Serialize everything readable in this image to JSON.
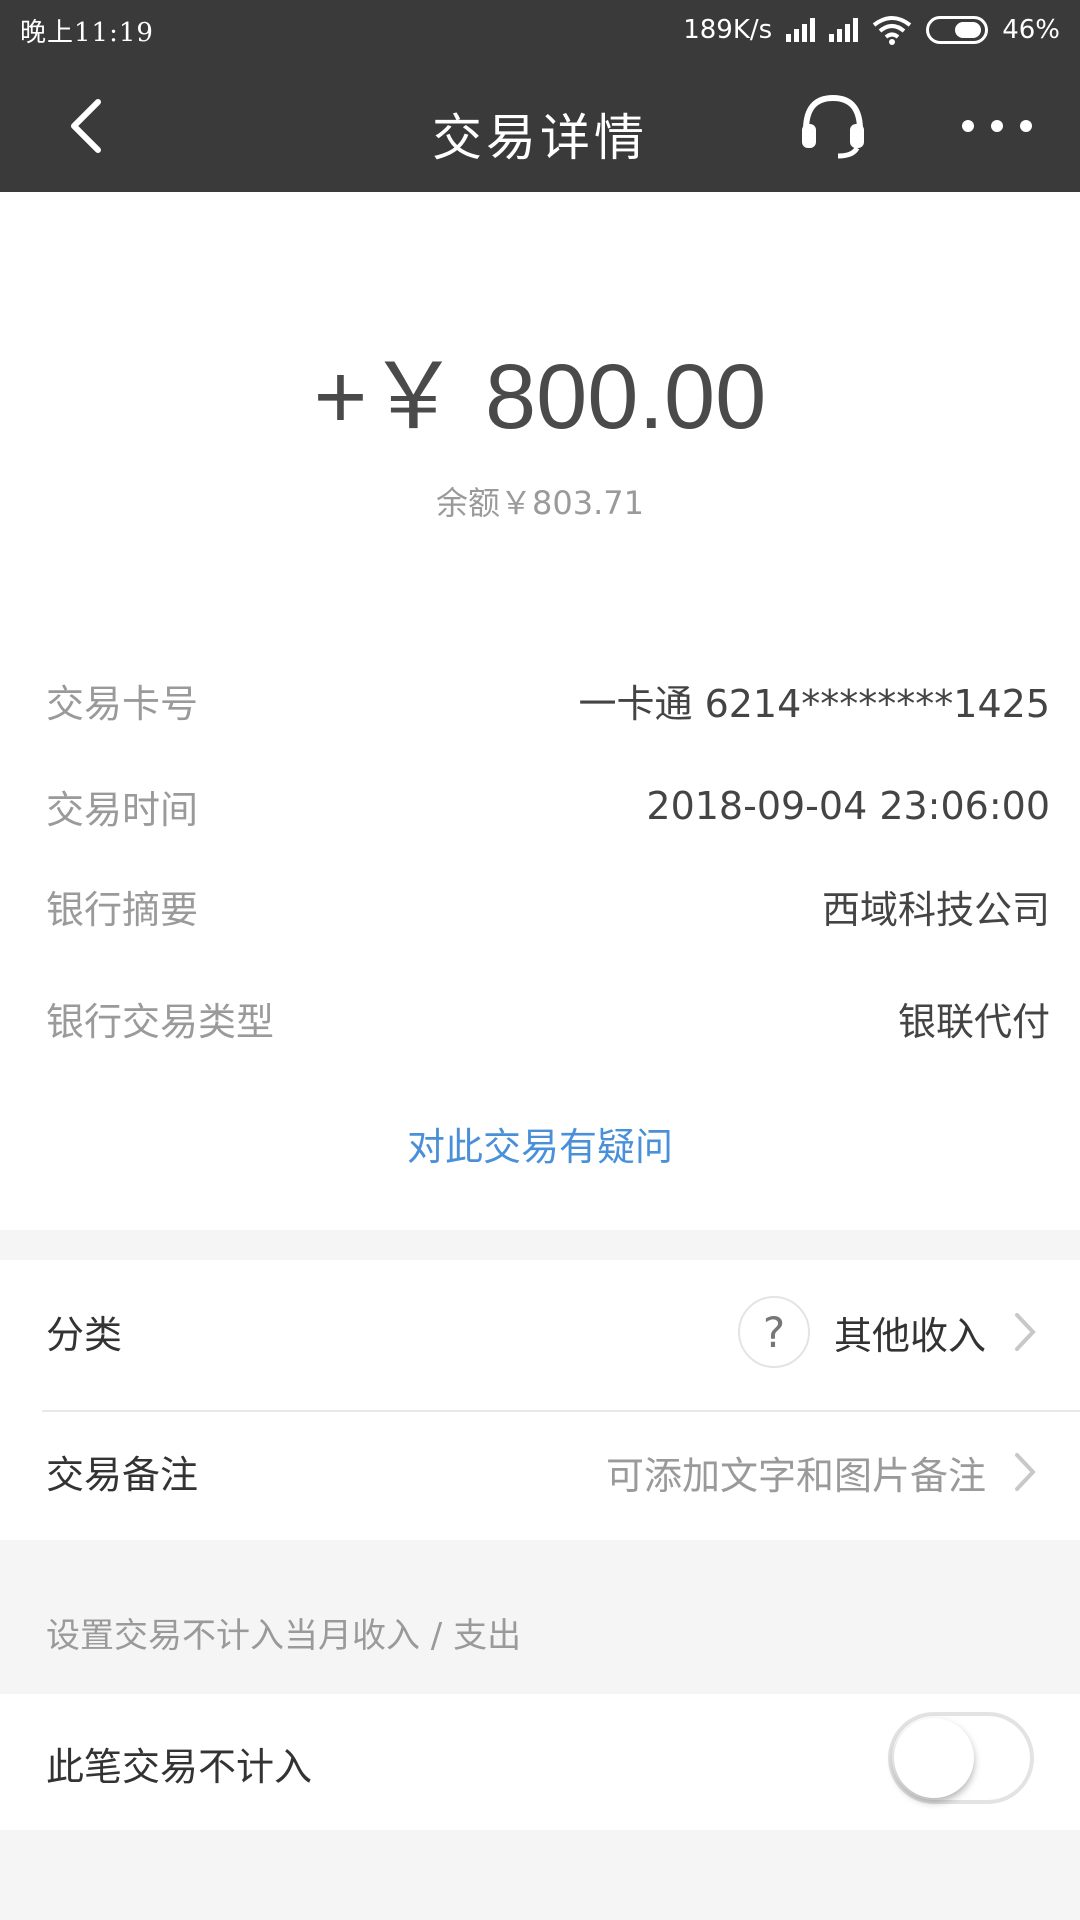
{
  "status_bar": {
    "time": "晚上11:19",
    "network_speed": "189K/s",
    "battery": "46%"
  },
  "app_bar": {
    "title": "交易详情",
    "back_icon": "chevron-left-icon",
    "service_icon": "headset-icon",
    "more_icon": "more-dots-icon"
  },
  "summary": {
    "amount": "+￥ 800.00",
    "balance": "余额￥803.71"
  },
  "details": [
    {
      "label": "交易卡号",
      "value": "一卡通 6214********1425"
    },
    {
      "label": "交易时间",
      "value": "2018-09-04 23:06:00"
    },
    {
      "label": "银行摘要",
      "value": "西域科技公司"
    },
    {
      "label": "银行交易类型",
      "value": "银联代付"
    }
  ],
  "question_link": "对此交易有疑问",
  "category": {
    "label": "分类",
    "icon_text": "?",
    "value": "其他收入"
  },
  "note": {
    "label": "交易备注",
    "placeholder": "可添加文字和图片备注"
  },
  "section_header": "设置交易不计入当月收入 / 支出",
  "exclude_toggle": {
    "label": "此笔交易不计入",
    "enabled": false
  },
  "colors": {
    "app_bar": "#3a3a3a",
    "link": "#4a90d9",
    "background": "#f5f5f5"
  }
}
